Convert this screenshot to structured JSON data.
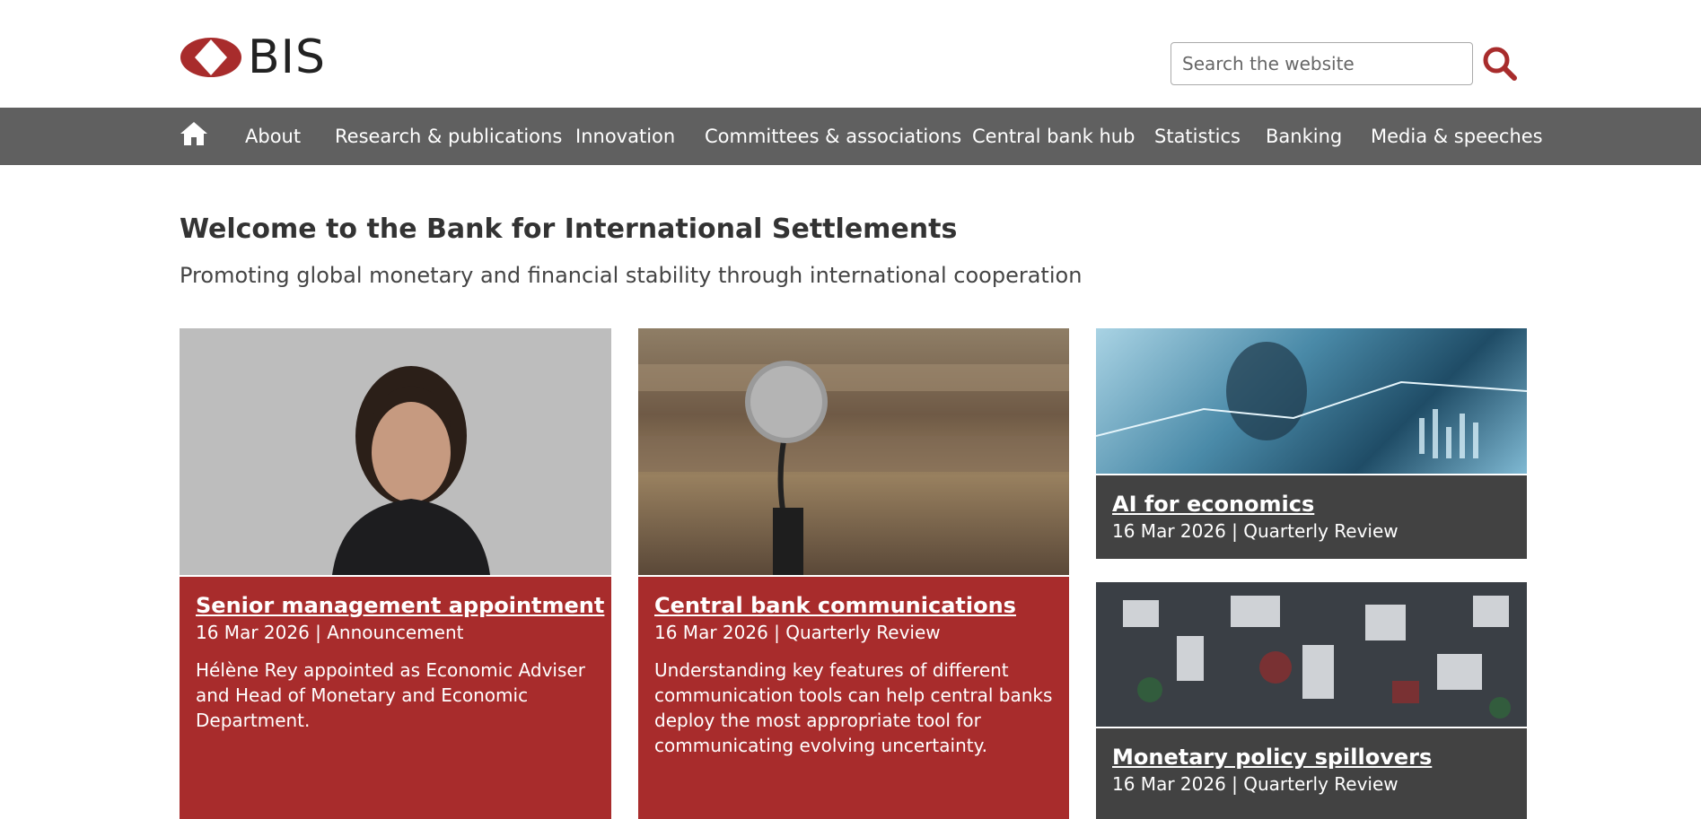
{
  "header": {
    "logo_text": "BIS",
    "search_placeholder": "Search the website",
    "colors": {
      "brand_red": "#a82c2c",
      "nav_bg": "#606060",
      "dark_panel": "#424242"
    }
  },
  "nav": {
    "home_icon": "home-icon",
    "items": [
      "About",
      "Research & publications",
      "Innovation",
      "Committees & associations",
      "Central bank hub",
      "Statistics",
      "Banking",
      "Media & speeches"
    ]
  },
  "main": {
    "title": "Welcome to the Bank for International Settlements",
    "subtitle": "Promoting global monetary and financial stability through international cooperation"
  },
  "cards": [
    {
      "title": "Senior management appointment",
      "date": "16 Mar 2026",
      "category": "Announcement",
      "meta": "16 Mar 2026 | Announcement",
      "description": "Hélène Rey appointed as Economic Adviser and Head of Monetary and Economic Department."
    },
    {
      "title": "Central bank communications",
      "date": "16 Mar 2026",
      "category": "Quarterly Review",
      "meta": "16 Mar 2026 | Quarterly Review",
      "description": "Understanding key features of different communication tools can help central banks deploy the most appropriate tool for communicating evolving uncertainty."
    },
    {
      "title": "AI for economics",
      "date": "16 Mar 2026",
      "category": "Quarterly Review",
      "meta": "16 Mar 2026 | Quarterly Review"
    },
    {
      "title": "Monetary policy spillovers",
      "date": "16 Mar 2026",
      "category": "Quarterly Review",
      "meta": "16 Mar 2026 | Quarterly Review"
    }
  ]
}
